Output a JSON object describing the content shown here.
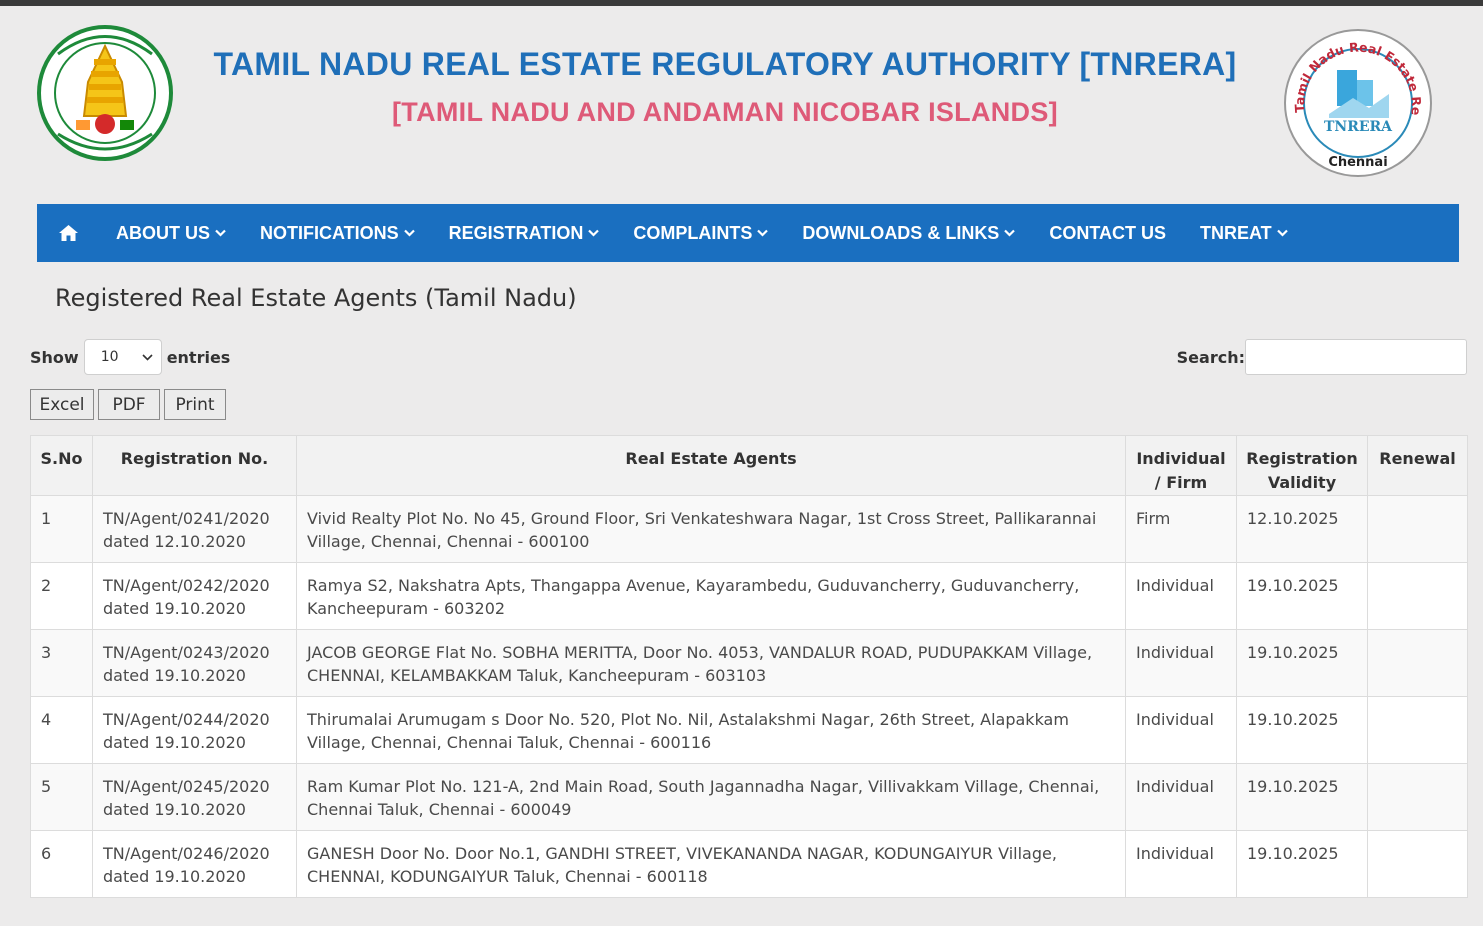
{
  "header": {
    "title": "TAMIL NADU REAL ESTATE REGULATORY AUTHORITY [TNRERA]",
    "subtitle": "[TAMIL NADU AND ANDAMAN NICOBAR ISLANDS]",
    "right_logo": {
      "ring_text": "Tamil Nadu Real Estate Regulatory Authority",
      "center_text": "TNRERA",
      "city": "Chennai"
    }
  },
  "nav": {
    "home_icon": "home-icon",
    "items": [
      {
        "label": "ABOUT US",
        "dropdown": true
      },
      {
        "label": "NOTIFICATIONS",
        "dropdown": true
      },
      {
        "label": "REGISTRATION",
        "dropdown": true
      },
      {
        "label": "COMPLAINTS",
        "dropdown": true
      },
      {
        "label": "DOWNLOADS & LINKS",
        "dropdown": true
      },
      {
        "label": "CONTACT US",
        "dropdown": false
      },
      {
        "label": "TNREAT",
        "dropdown": true
      }
    ]
  },
  "page": {
    "heading": "Registered Real Estate Agents (Tamil Nadu)"
  },
  "controls": {
    "show_label": "Show",
    "entries_value": "10",
    "entries_label": "entries",
    "search_label": "Search:",
    "buttons": [
      "Excel",
      "PDF",
      "Print"
    ]
  },
  "table": {
    "headers": [
      "S.No",
      "Registration No.",
      "Real Estate Agents",
      "Individual / Firm",
      "Registration Validity",
      "Renewal"
    ],
    "rows": [
      {
        "sno": "1",
        "reg_no": "TN/Agent/0241/2020",
        "dated": "dated 12.10.2020",
        "agent": "Vivid Realty Plot No. No 45, Ground Floor, Sri Venkateshwara Nagar, 1st Cross Street, Pallikarannai Village, Chennai, Chennai - 600100",
        "type": "Firm",
        "validity": "12.10.2025",
        "renewal": ""
      },
      {
        "sno": "2",
        "reg_no": "TN/Agent/0242/2020",
        "dated": "dated 19.10.2020",
        "agent": "Ramya S2, Nakshatra Apts, Thangappa Avenue, Kayarambedu, Guduvancherry, Guduvancherry, Kancheepuram - 603202",
        "type": "Individual",
        "validity": "19.10.2025",
        "renewal": ""
      },
      {
        "sno": "3",
        "reg_no": "TN/Agent/0243/2020",
        "dated": "dated 19.10.2020",
        "agent": "JACOB GEORGE Flat No. SOBHA MERITTA, Door No. 4053, VANDALUR ROAD, PUDUPAKKAM Village, CHENNAI, KELAMBAKKAM Taluk, Kancheepuram - 603103",
        "type": "Individual",
        "validity": "19.10.2025",
        "renewal": ""
      },
      {
        "sno": "4",
        "reg_no": "TN/Agent/0244/2020",
        "dated": "dated 19.10.2020",
        "agent": "Thirumalai Arumugam s Door No. 520, Plot No. Nil, Astalakshmi Nagar, 26th Street, Alapakkam Village, Chennai, Chennai Taluk, Chennai - 600116",
        "type": "Individual",
        "validity": "19.10.2025",
        "renewal": ""
      },
      {
        "sno": "5",
        "reg_no": "TN/Agent/0245/2020",
        "dated": "dated 19.10.2020",
        "agent": "Ram Kumar Plot No. 121-A, 2nd Main Road, South Jagannadha Nagar, Villivakkam Village, Chennai, Chennai Taluk, Chennai - 600049",
        "type": "Individual",
        "validity": "19.10.2025",
        "renewal": ""
      },
      {
        "sno": "6",
        "reg_no": "TN/Agent/0246/2020",
        "dated": "dated 19.10.2020",
        "agent": "GANESH Door No. Door No.1, GANDHI STREET, VIVEKANANDA NAGAR, KODUNGAIYUR Village, CHENNAI, KODUNGAIYUR Taluk, Chennai - 600118",
        "type": "Individual",
        "validity": "19.10.2025",
        "renewal": ""
      }
    ]
  },
  "colors": {
    "title_blue": "#1f6fb8",
    "subtitle_pink": "#de5a78",
    "nav_blue": "#1a6fc0",
    "page_bg": "#ecebeb"
  }
}
